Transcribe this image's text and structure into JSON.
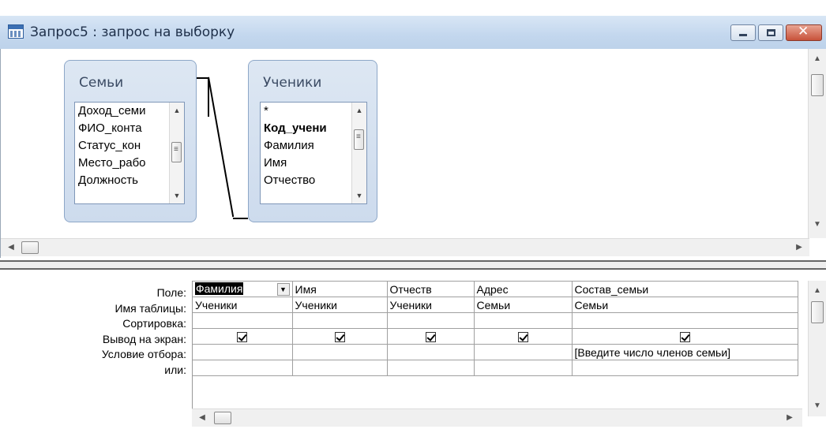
{
  "window": {
    "title": "Запрос5 : запрос на выборку"
  },
  "upper": {
    "tables": [
      {
        "title": "Семьи",
        "fields": [
          "Доход_семи",
          "ФИО_конта",
          "Статус_кон",
          "Место_рабо",
          "Должность"
        ]
      },
      {
        "title": "Ученики",
        "fields": [
          "*",
          "Код_учени",
          "Фамилия",
          "Имя",
          "Отчество"
        ],
        "bold_field_index": 1
      }
    ]
  },
  "design_grid": {
    "row_labels": [
      "Поле:",
      "Имя таблицы:",
      "Сортировка:",
      "Вывод на экран:",
      "Условие отбора:",
      "или:"
    ],
    "columns": [
      {
        "field": "Фамилия",
        "table": "Ученики",
        "sort": "",
        "show": true,
        "criteria": "",
        "or": ""
      },
      {
        "field": "Имя",
        "table": "Ученики",
        "sort": "",
        "show": true,
        "criteria": "",
        "or": ""
      },
      {
        "field": "Отчеств",
        "table": "Ученики",
        "sort": "",
        "show": true,
        "criteria": "",
        "or": ""
      },
      {
        "field": "Адрес",
        "table": "Семьи",
        "sort": "",
        "show": true,
        "criteria": "",
        "or": ""
      },
      {
        "field": "Состав_семьи",
        "table": "Семьи",
        "sort": "",
        "show": true,
        "criteria": "[Введите число членов семьи]",
        "or": ""
      }
    ]
  },
  "icons": {
    "title_icon": "query-icon",
    "minimize": "minimize-icon",
    "maximize": "maximize-icon",
    "close": "close-icon"
  }
}
